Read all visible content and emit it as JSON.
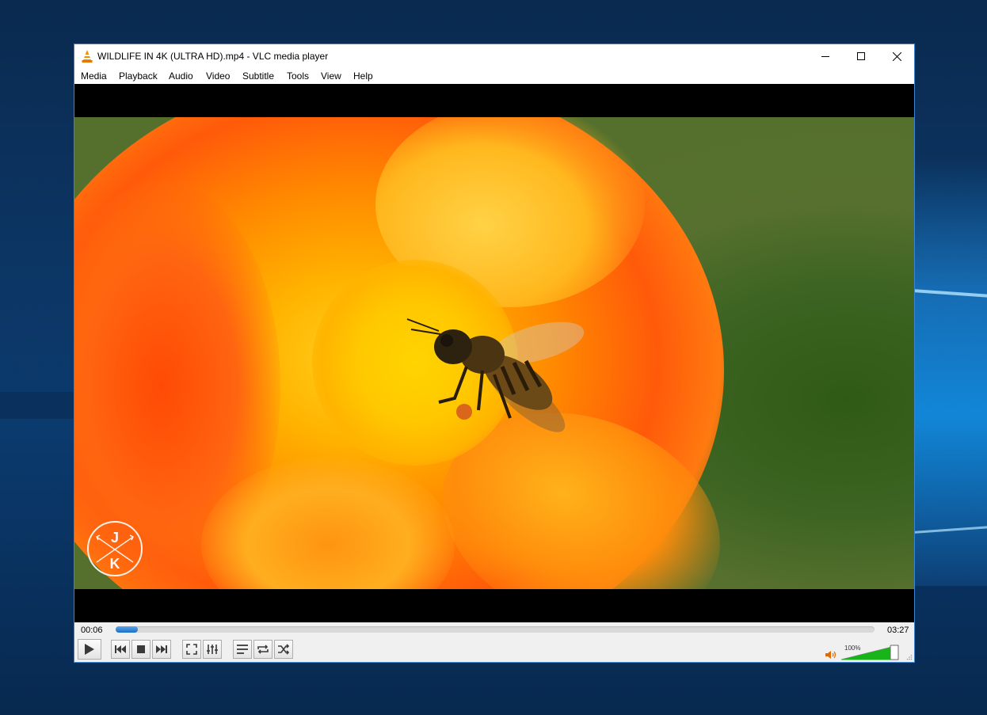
{
  "window": {
    "title": "WILDLIFE IN 4K (ULTRA HD).mp4 - VLC media player"
  },
  "menu": [
    "Media",
    "Playback",
    "Audio",
    "Video",
    "Subtitle",
    "Tools",
    "View",
    "Help"
  ],
  "watermark": {
    "letters": [
      "J",
      "K"
    ]
  },
  "playback": {
    "elapsed": "00:06",
    "total": "03:27",
    "progress_fraction": 0.029
  },
  "volume": {
    "label": "100%",
    "level_fraction": 1.0
  },
  "colors": {
    "window_border": "#3a86d3",
    "seek_fill": "#1e6ec5",
    "volume_fill": "#19b419"
  },
  "icons": {
    "app": "vlc-cone-icon",
    "play": "play-icon",
    "prev": "previous-icon",
    "stop": "stop-icon",
    "next": "next-icon",
    "fullscreen": "fullscreen-icon",
    "extended": "extended-settings-icon",
    "playlist": "playlist-icon",
    "loop": "loop-icon",
    "shuffle": "shuffle-icon",
    "volume": "speaker-icon"
  }
}
